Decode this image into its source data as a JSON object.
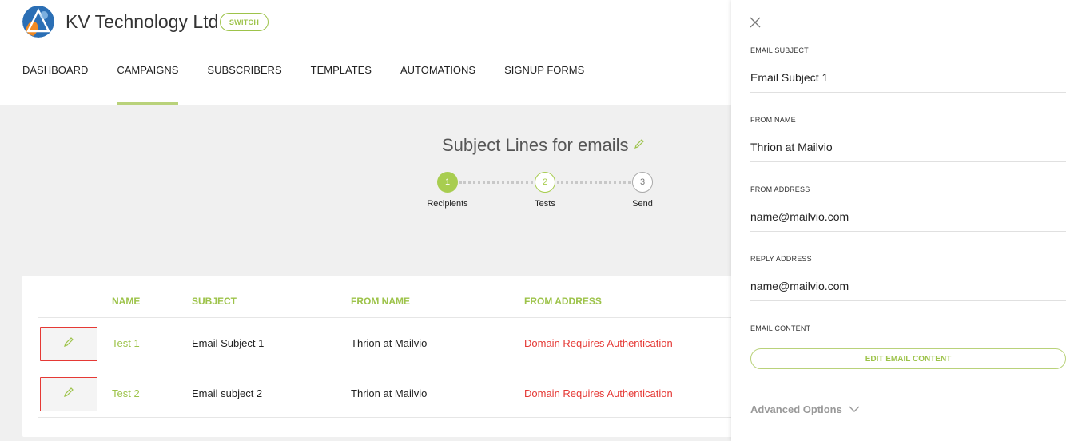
{
  "header": {
    "company_name": "KV Technology Ltd",
    "switch_label": "SWITCH",
    "nav": [
      "DASHBOARD",
      "CAMPAIGNS",
      "SUBSCRIBERS",
      "TEMPLATES",
      "AUTOMATIONS",
      "SIGNUP FORMS"
    ],
    "active_nav": "CAMPAIGNS"
  },
  "campaign": {
    "title": "Subject Lines for emails",
    "steps": [
      {
        "number": "1",
        "label": "Recipients",
        "state": "active"
      },
      {
        "number": "2",
        "label": "Tests",
        "state": "current"
      },
      {
        "number": "3",
        "label": "Send",
        "state": "pending"
      }
    ]
  },
  "table": {
    "headers": {
      "name": "NAME",
      "subject": "SUBJECT",
      "from_name": "FROM NAME",
      "from_address": "FROM ADDRESS"
    },
    "rows": [
      {
        "name": "Test 1",
        "subject": "Email Subject 1",
        "from_name": "Thrion at Mailvio",
        "from_address": "Domain Requires Authentication"
      },
      {
        "name": "Test 2",
        "subject": "Email subject 2",
        "from_name": "Thrion at Mailvio",
        "from_address": "Domain Requires Authentication"
      }
    ]
  },
  "panel": {
    "email_subject_label": "EMAIL SUBJECT",
    "email_subject": "Email Subject 1",
    "from_name_label": "FROM NAME",
    "from_name": "Thrion at Mailvio",
    "from_address_label": "FROM ADDRESS",
    "from_address": "name@mailvio.com",
    "reply_address_label": "REPLY ADDRESS",
    "reply_address": "name@mailvio.com",
    "email_content_label": "EMAIL CONTENT",
    "edit_content_button": "EDIT EMAIL CONTENT",
    "advanced_options": "Advanced Options"
  },
  "colors": {
    "accent": "#9dc34a",
    "error": "#e53935"
  },
  "icons": [
    "logo",
    "pencil-icon",
    "close-icon",
    "chevron-down-icon"
  ]
}
